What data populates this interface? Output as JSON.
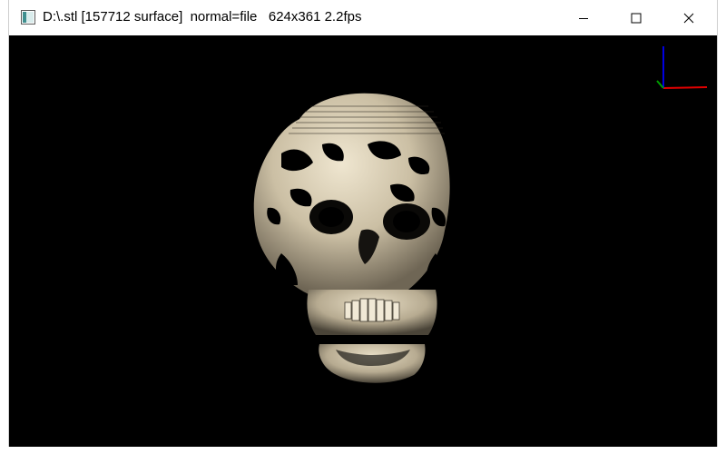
{
  "window": {
    "title": "D:\\.stl [157712 surface]  normal=file   624x361 2.2fps",
    "icon": "app-window-icon",
    "buttons": [
      "minimize-icon",
      "maximize-icon",
      "close-icon"
    ]
  },
  "viewport": {
    "background": "#000000",
    "model_color": "#d8ccb2",
    "axes": {
      "x_color": "#e00000",
      "y_color": "#00a000",
      "z_color": "#0000e0"
    }
  }
}
